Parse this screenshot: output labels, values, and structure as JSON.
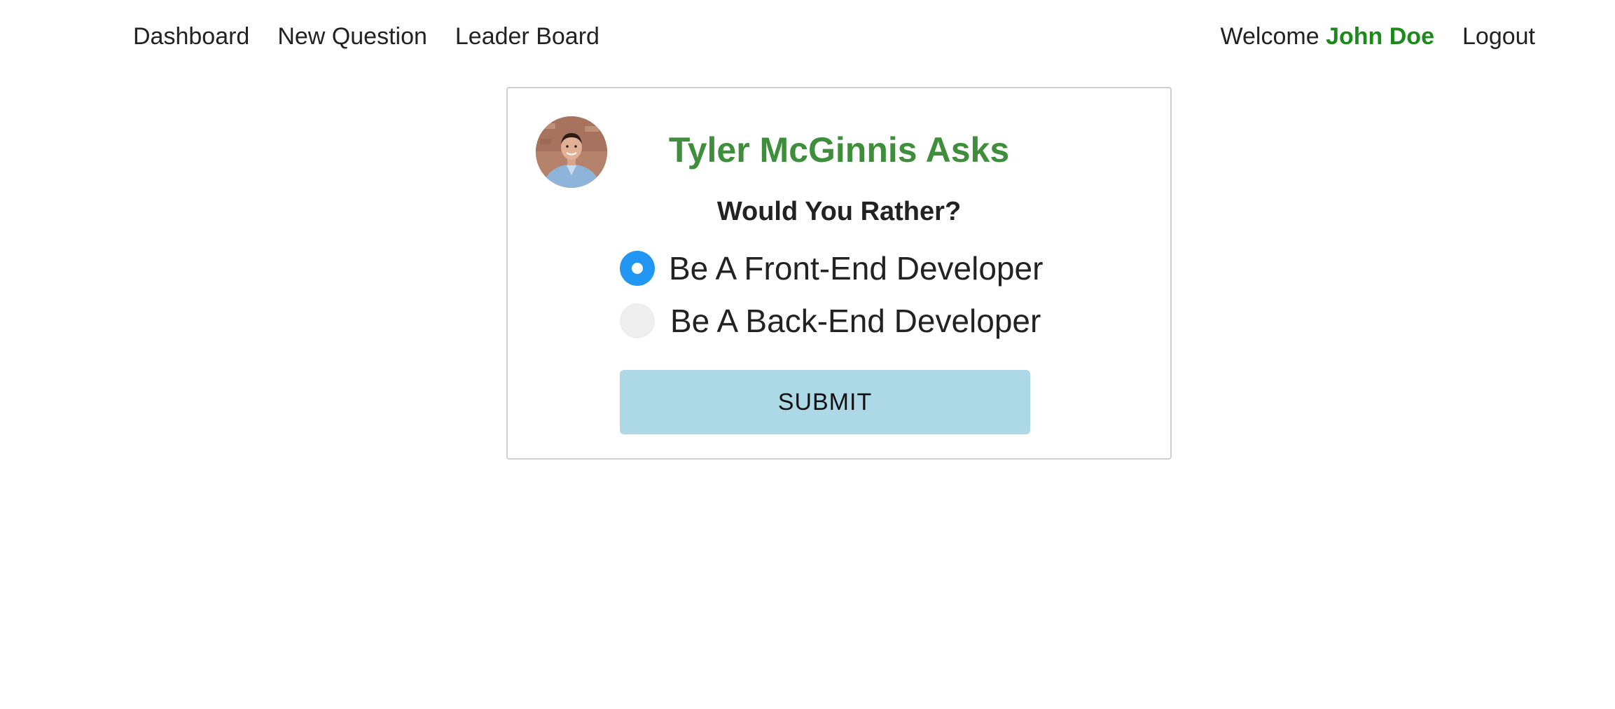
{
  "nav": {
    "links": [
      "Dashboard",
      "New Question",
      "Leader Board"
    ],
    "welcome_prefix": "Welcome",
    "user_name": "John Doe",
    "logout": "Logout"
  },
  "question": {
    "author_heading": "Tyler McGinnis Asks",
    "prompt": "Would You Rather?",
    "options": [
      {
        "label": "Be A Front-End Developer",
        "selected": true
      },
      {
        "label": "Be A Back-End Developer",
        "selected": false
      }
    ],
    "submit_label": "SUBMIT"
  },
  "colors": {
    "user_name": "#1b8a1b",
    "author_heading": "#3e8e3b",
    "radio_selected": "#2196f3",
    "submit_bg": "#add8e6"
  }
}
